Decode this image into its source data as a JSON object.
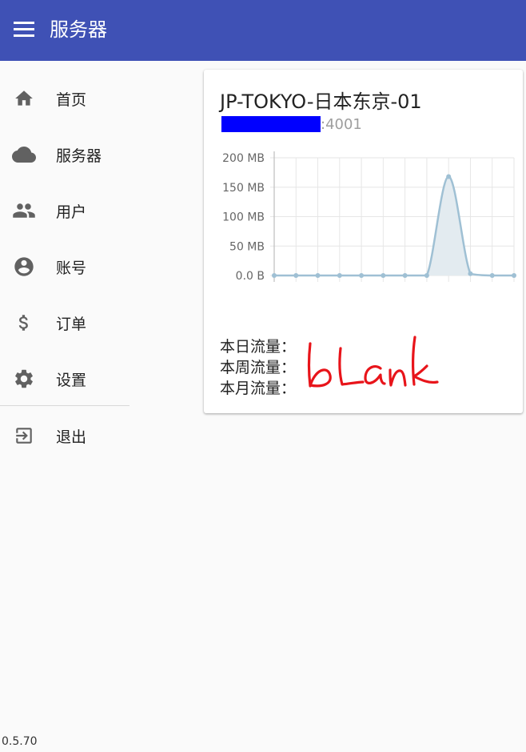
{
  "appbar": {
    "title": "服务器",
    "menu_icon": "menu-icon"
  },
  "nav": [
    {
      "label": "首页",
      "icon": "home-icon"
    },
    {
      "label": "服务器",
      "icon": "cloud-icon"
    },
    {
      "label": "用户",
      "icon": "people-icon"
    },
    {
      "label": "账号",
      "icon": "account-circle-icon"
    },
    {
      "label": "订单",
      "icon": "dollar-icon"
    },
    {
      "label": "设置",
      "icon": "gear-icon"
    }
  ],
  "logout": {
    "label": "退出",
    "icon": "logout-icon"
  },
  "version": "0.5.70",
  "server": {
    "name": "JP-TOKYO-日本东京-01",
    "port_suffix": ":4001",
    "stats": {
      "today_label": "本日流量：",
      "week_label": "本周流量：",
      "month_label": "本月流量："
    },
    "annotation": "blank"
  },
  "colors": {
    "primary": "#3f51b5",
    "line": "#9fc0d4",
    "fill": "#e3ebf0",
    "redact": "#0000ff",
    "ink": "#e8141a"
  },
  "chart_data": {
    "type": "area",
    "x": [
      0,
      1,
      2,
      3,
      4,
      5,
      6,
      7,
      8,
      9,
      10,
      11
    ],
    "values": [
      0,
      0,
      0,
      0,
      0,
      0,
      0,
      0,
      168,
      3,
      0,
      0
    ],
    "yticks": [
      "200 MB",
      "150 MB",
      "100 MB",
      "50 MB",
      "0.0 B"
    ],
    "ytick_values": [
      200,
      150,
      100,
      50,
      0
    ],
    "ylim": [
      0,
      200
    ],
    "unit": "MB",
    "grid": true,
    "smooth": true
  }
}
